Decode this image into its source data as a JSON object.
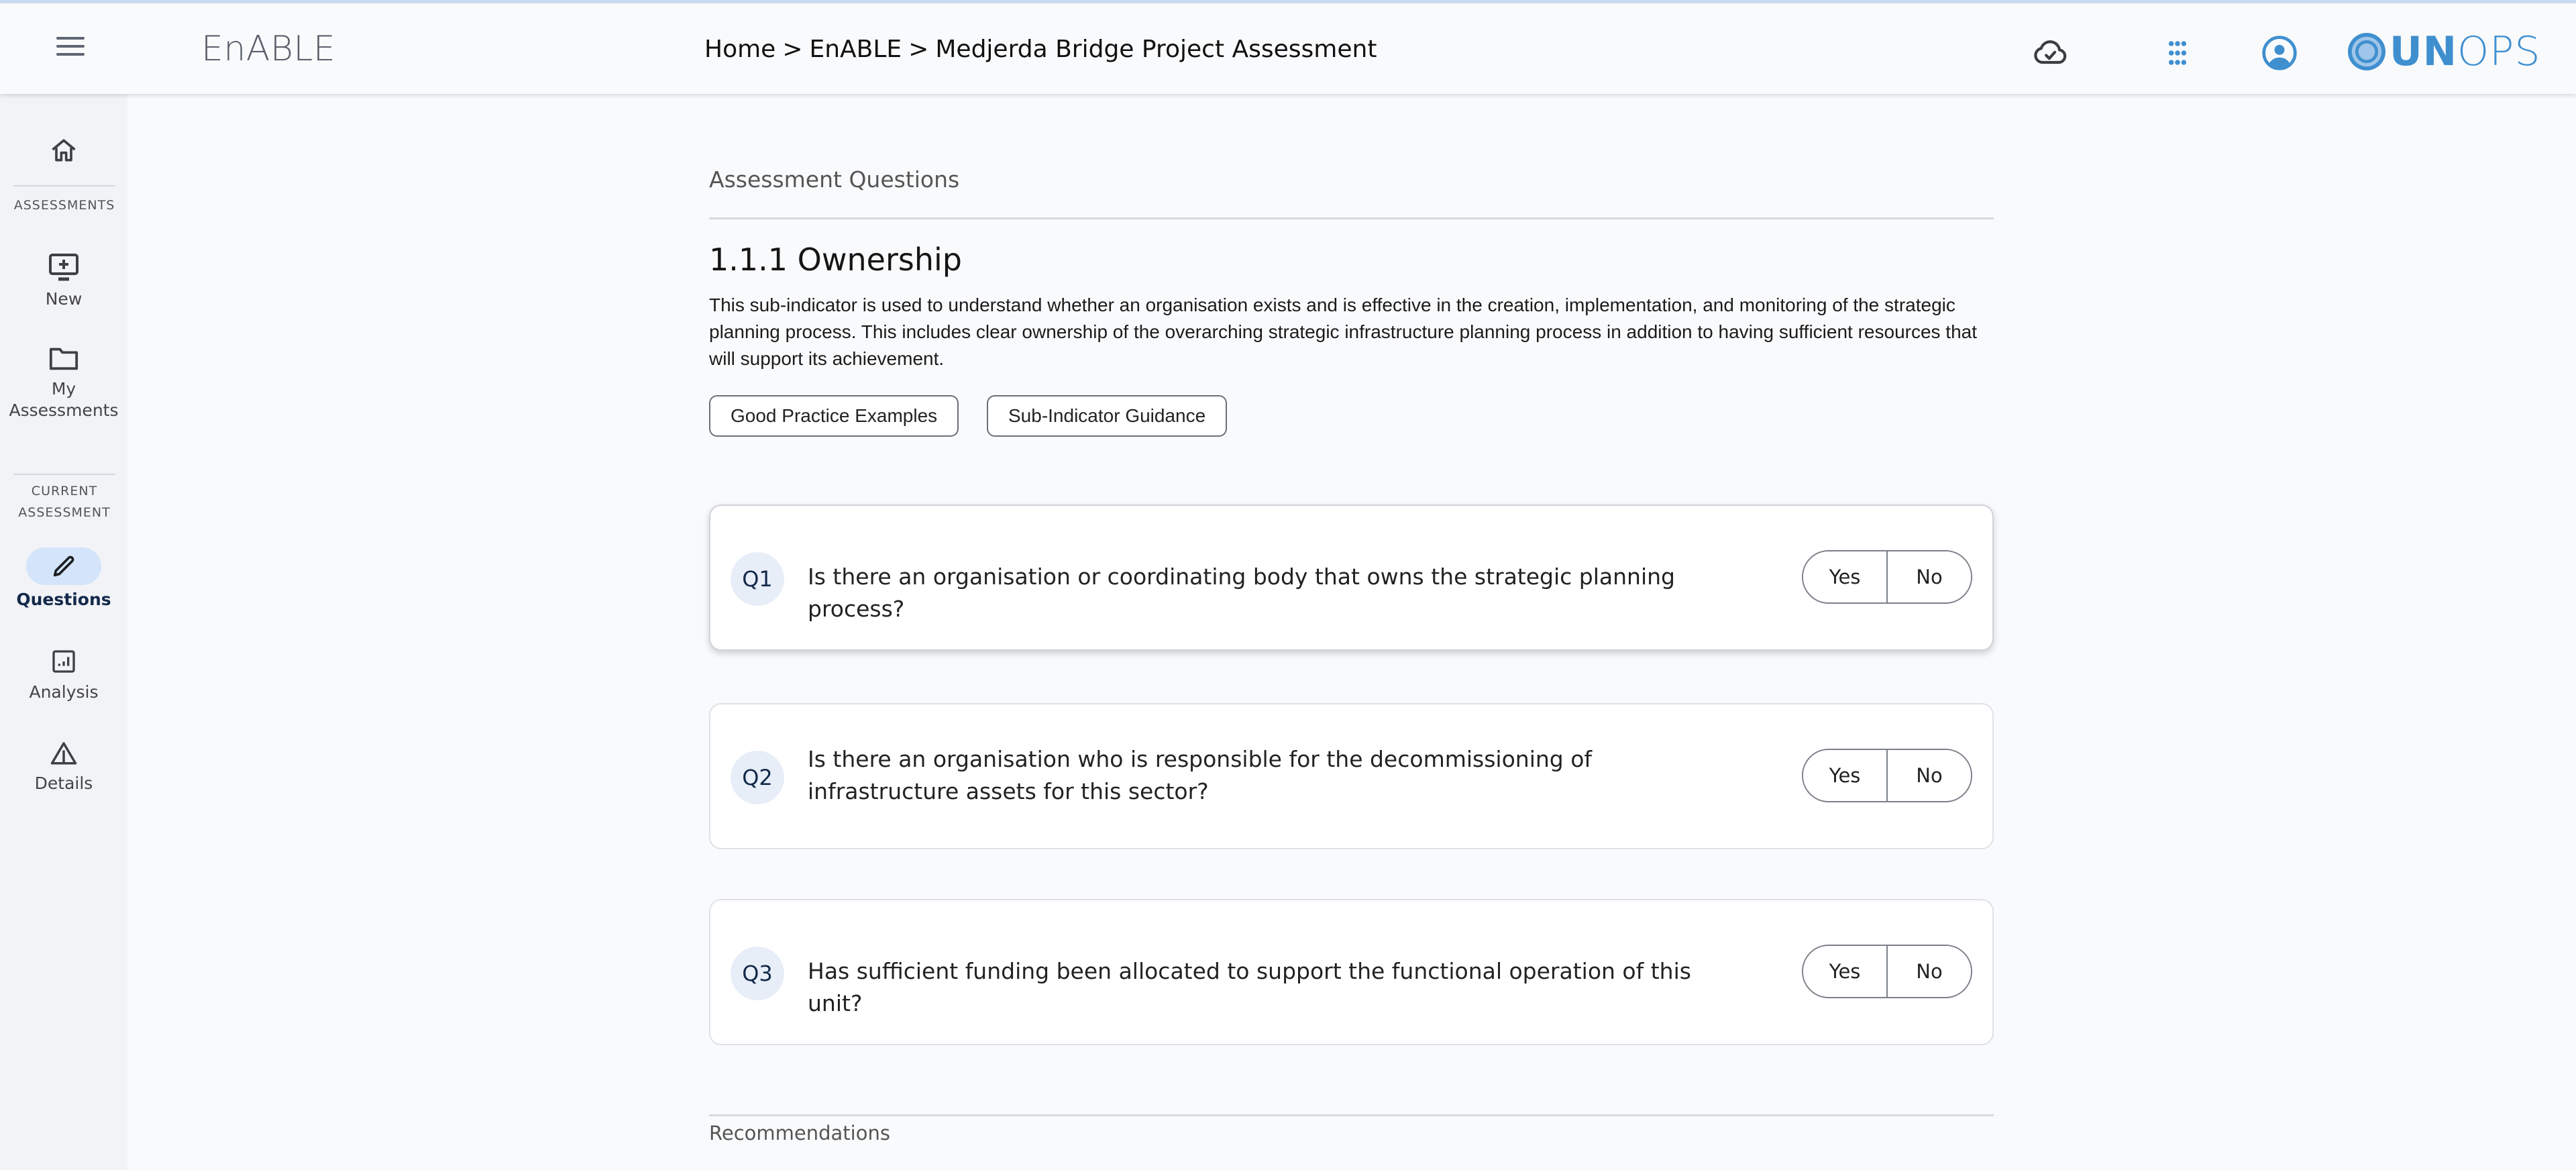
{
  "header": {
    "app_title": "EnABLE",
    "breadcrumb": [
      "Home",
      "EnABLE",
      "Medjerda Bridge Project Assessment"
    ],
    "breadcrumb_separator": ">",
    "icons": {
      "menu": "hamburger-menu-icon",
      "sync": "cloud-check-icon",
      "apps": "apps-grid-icon",
      "account": "account-circle-icon"
    },
    "logo_text_bold": "UN",
    "logo_text_light": "OPS",
    "accent_color": "#3f8fcf"
  },
  "sidebar": {
    "home_icon": "home-icon",
    "section_assessments": "ASSESSMENTS",
    "section_current": "CURRENT ASSESSMENT",
    "items": [
      {
        "label": "New",
        "icon": "monitor-plus-icon"
      },
      {
        "label": "My Assessments",
        "icon": "folder-icon"
      },
      {
        "label": "Questions",
        "icon": "pencil-icon",
        "active": true
      },
      {
        "label": "Analysis",
        "icon": "chart-box-icon"
      },
      {
        "label": "Details",
        "icon": "warning-triangle-icon"
      }
    ],
    "active_color": "#d4e5fb"
  },
  "main": {
    "section_label": "Assessment Questions",
    "sub_indicator_title": "1.1.1 Ownership",
    "sub_indicator_description": "This sub-indicator is used to understand whether an organisation exists and is effective in the creation, implementation, and monitoring of the strategic planning process. This includes clear ownership of the overarching strategic infrastructure planning process in addition to having sufficient resources that will support its achievement.",
    "buttons": {
      "good_practice": "Good Practice Examples",
      "guidance": "Sub-Indicator Guidance"
    },
    "questions": [
      {
        "number": "Q1",
        "text": "Is there an organisation or coordinating body that owns the strategic planning process?",
        "yes": "Yes",
        "no": "No"
      },
      {
        "number": "Q2",
        "text": "Is there an organisation who is responsible for the decommissioning of infrastructure assets for this sector?",
        "yes": "Yes",
        "no": "No"
      },
      {
        "number": "Q3",
        "text": "Has sufficient funding been allocated to support the functional operation of this unit?",
        "yes": "Yes",
        "no": "No"
      }
    ],
    "recommendations_label": "Recommendations"
  }
}
